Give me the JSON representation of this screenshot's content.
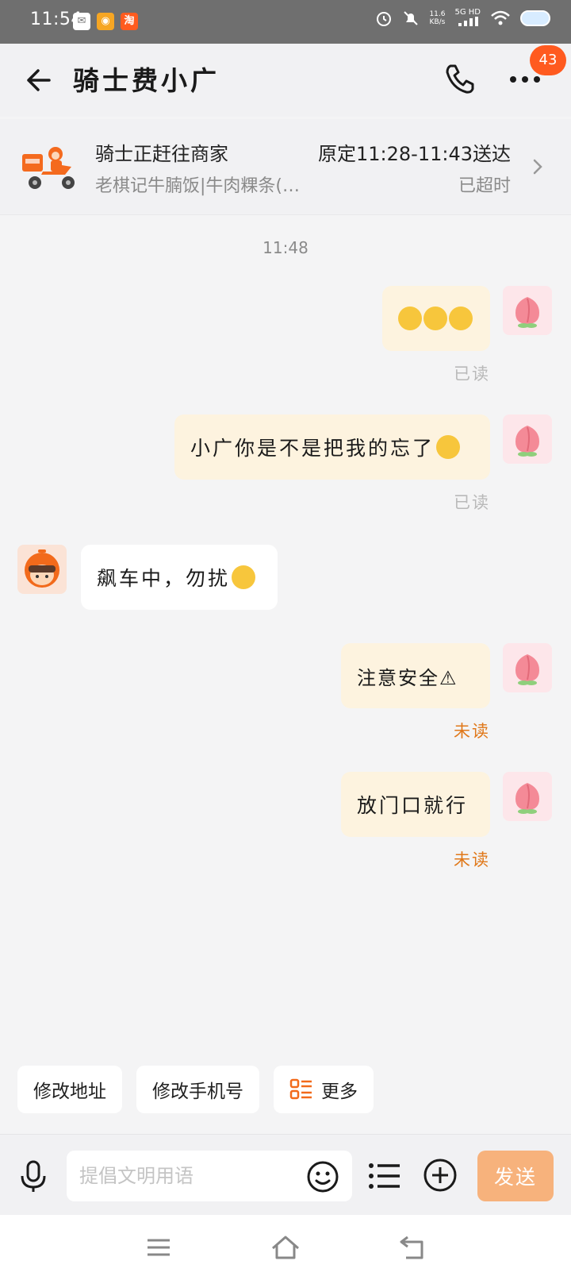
{
  "status_bar": {
    "time": "11:54",
    "net_speed_value": "11.6",
    "net_speed_unit": "KB/s",
    "signal_label": "5G HD",
    "app_icons": [
      "wechat-icon",
      "weibo-icon",
      "taobao-icon"
    ]
  },
  "header": {
    "title": "骑士费小广",
    "badge_count": "43"
  },
  "order": {
    "status": "骑士正赶往商家",
    "shop": "老棋记牛腩饭|牛肉粿条(…",
    "eta": "原定11:28-11:43送达",
    "overtime": "已超时"
  },
  "chat": {
    "timestamp": "11:48",
    "messages": [
      {
        "from": "me",
        "text": "",
        "emojis": [
          "monocle-face-emoji",
          "monocle-face-emoji",
          "monocle-face-emoji"
        ],
        "status": "已读"
      },
      {
        "from": "me",
        "text": "小广你是不是把我的忘了",
        "emojis": [
          "face-holding-back-tears-emoji"
        ],
        "status": "已读"
      },
      {
        "from": "rider",
        "text": "飙车中，勿扰",
        "emojis": [
          "sunglasses-face-emoji"
        ],
        "status": ""
      },
      {
        "from": "me",
        "text": "注意安全⚠",
        "emojis": [],
        "status": "未读"
      },
      {
        "from": "me",
        "text": "放门口就行",
        "emojis": [],
        "status": "未读"
      }
    ]
  },
  "quick_actions": {
    "change_address": "修改地址",
    "change_phone": "修改手机号",
    "more": "更多"
  },
  "input": {
    "placeholder": "提倡文明用语",
    "value": "",
    "send_label": "发送"
  },
  "colors": {
    "accent": "#ff5a1f",
    "unread": "#e0781a",
    "send_button": "#f7b27c",
    "outgoing_bubble": "#fdf3df"
  }
}
